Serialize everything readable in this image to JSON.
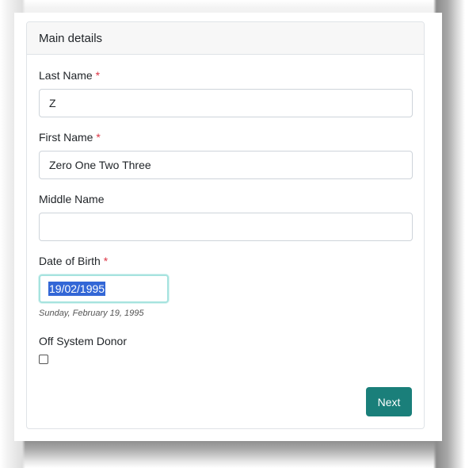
{
  "card": {
    "title": "Main details"
  },
  "fields": {
    "last_name": {
      "label": "Last Name",
      "required_mark": "*",
      "value": "Z"
    },
    "first_name": {
      "label": "First Name",
      "required_mark": "*",
      "value": "Zero One Two Three"
    },
    "middle_name": {
      "label": "Middle Name",
      "value": ""
    },
    "date_of_birth": {
      "label": "Date of Birth",
      "required_mark": "*",
      "value": "19/02/1995",
      "help_text": "Sunday, February 19, 1995"
    },
    "off_system_donor": {
      "label": "Off System Donor",
      "checked": false
    }
  },
  "actions": {
    "next_label": "Next"
  },
  "colors": {
    "primary_button": "#1a7f7a",
    "required": "#dc3545",
    "selection": "#3367d6",
    "focus_border": "#a6e3df"
  }
}
